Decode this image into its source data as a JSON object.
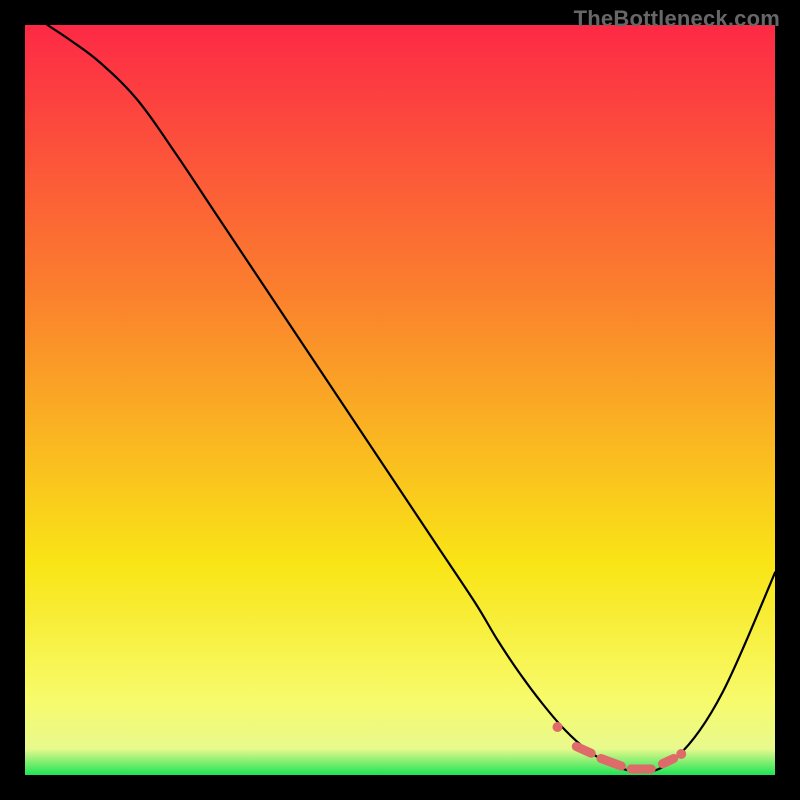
{
  "branding": {
    "watermark": "TheBottleneck.com"
  },
  "chart_data": {
    "type": "line",
    "title": "",
    "xlabel": "",
    "ylabel": "",
    "xlim": [
      0,
      100
    ],
    "ylim": [
      0,
      100
    ],
    "grid": false,
    "legend": false,
    "gradient": {
      "top": "#fd2946",
      "mid": "#f9e516",
      "bottom": "#1ee456"
    },
    "series": [
      {
        "name": "curve",
        "x": [
          3,
          6,
          10,
          15,
          20,
          25,
          30,
          35,
          40,
          45,
          50,
          55,
          60,
          63,
          66,
          69,
          72,
          75,
          78,
          81,
          84,
          87,
          90,
          93,
          96,
          100
        ],
        "y": [
          100,
          98,
          95,
          90,
          83,
          75.5,
          68,
          60.5,
          53,
          45.5,
          38,
          30.5,
          23,
          18,
          13.5,
          9.5,
          6,
          3.3,
          1.5,
          0.5,
          0.6,
          2.5,
          6,
          11,
          17.5,
          27
        ]
      }
    ],
    "annotations": {
      "dots": {
        "color": "#de6a6a",
        "x": [
          71,
          87.5
        ],
        "y": [
          6.4,
          2.8
        ]
      },
      "dash_segments": {
        "color": "#de6a6a",
        "segments": [
          {
            "x": [
              73.5,
              75.5
            ],
            "y": [
              3.8,
              2.9
            ]
          },
          {
            "x": [
              76.8,
              79.5
            ],
            "y": [
              2.2,
              1.2
            ]
          },
          {
            "x": [
              80.8,
              83.5
            ],
            "y": [
              0.8,
              0.8
            ]
          },
          {
            "x": [
              85,
              86.5
            ],
            "y": [
              1.5,
              2.2
            ]
          }
        ]
      }
    }
  }
}
